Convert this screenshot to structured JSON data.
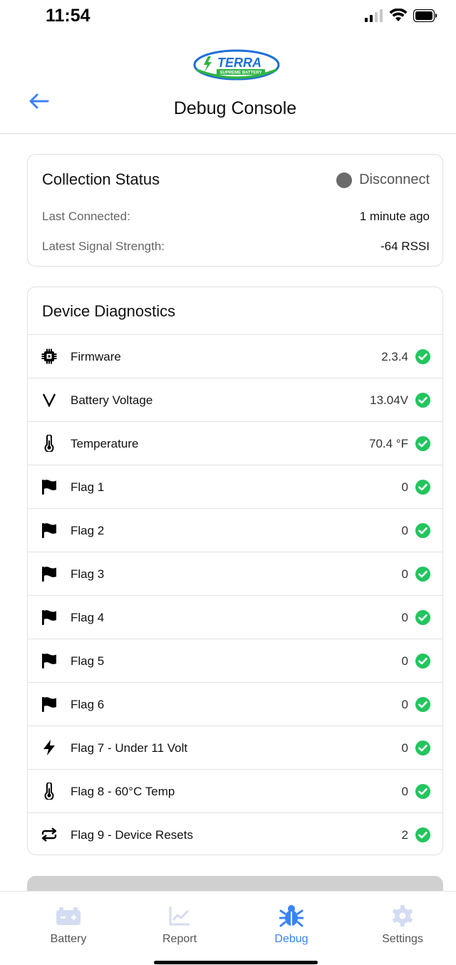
{
  "statusbar": {
    "time": "11:54"
  },
  "header": {
    "logo_text": "TERRA",
    "logo_subtext": "SUPREME BATTERY",
    "title": "Debug Console"
  },
  "collection_status": {
    "title": "Collection Status",
    "state": "Disconnect",
    "last_connected_label": "Last Connected:",
    "last_connected_value": "1 minute ago",
    "signal_label": "Latest Signal Strength:",
    "signal_value": "-64 RSSI"
  },
  "diagnostics": {
    "title": "Device Diagnostics",
    "rows": [
      {
        "icon": "chip-icon",
        "label": "Firmware",
        "value": "2.3.4"
      },
      {
        "icon": "voltage-icon",
        "label": "Battery Voltage",
        "value": "13.04V"
      },
      {
        "icon": "thermometer-icon",
        "label": "Temperature",
        "value": "70.4 °F"
      },
      {
        "icon": "flag-icon",
        "label": "Flag 1",
        "value": "0"
      },
      {
        "icon": "flag-icon",
        "label": "Flag 2",
        "value": "0"
      },
      {
        "icon": "flag-icon",
        "label": "Flag 3",
        "value": "0"
      },
      {
        "icon": "flag-icon",
        "label": "Flag 4",
        "value": "0"
      },
      {
        "icon": "flag-icon",
        "label": "Flag 5",
        "value": "0"
      },
      {
        "icon": "flag-icon",
        "label": "Flag 6",
        "value": "0"
      },
      {
        "icon": "bolt-icon",
        "label": "Flag 7 - Under 11 Volt",
        "value": "0"
      },
      {
        "icon": "thermometer-icon",
        "label": "Flag 8 - 60°C Temp",
        "value": "0"
      },
      {
        "icon": "repeat-icon",
        "label": "Flag 9 - Device Resets",
        "value": "2"
      }
    ]
  },
  "tabs": [
    {
      "label": "Battery",
      "icon": "battery-icon",
      "active": false
    },
    {
      "label": "Report",
      "icon": "chart-icon",
      "active": false
    },
    {
      "label": "Debug",
      "icon": "bug-icon",
      "active": true
    },
    {
      "label": "Settings",
      "icon": "gear-icon",
      "active": false
    }
  ],
  "colors": {
    "accent": "#3b82f6",
    "ok": "#22c55e",
    "disconnected": "#6b6b6b",
    "logo_blue": "#1e6fd9",
    "logo_green": "#2fb344"
  }
}
